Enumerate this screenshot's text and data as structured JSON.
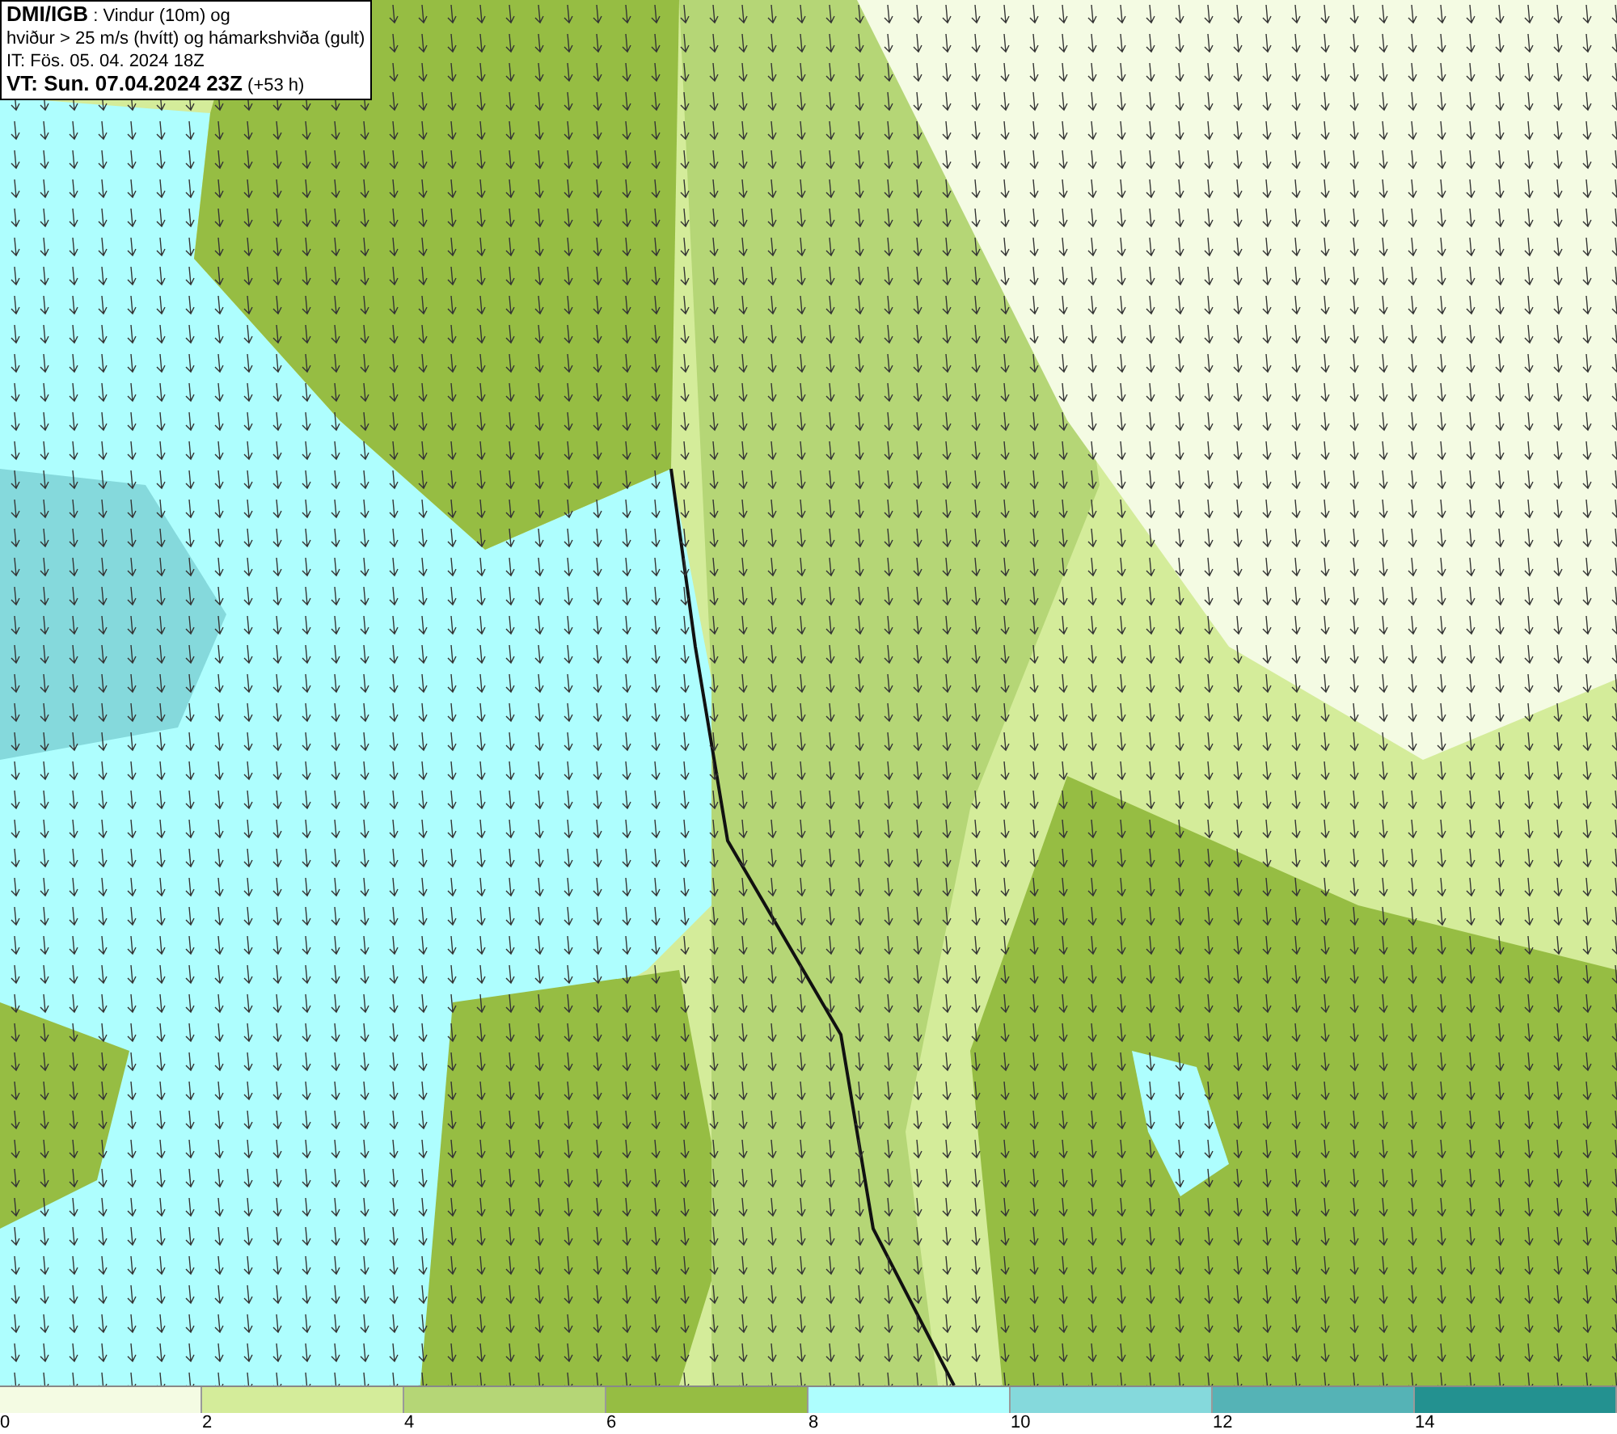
{
  "title_box": {
    "lines": [
      "**DMI/IGB** : Vindur (10m) og",
      "hviður > 25 m/s (hvítt) og hámarkshviða (gult)",
      "IT: Fös. 05. 04. 2024 18Z",
      "**VT: Sun. 07.04.2024 23Z** (+53 h)"
    ]
  },
  "legend": {
    "segments": [
      {
        "color": "#f4fbe3"
      },
      {
        "color": "#d4ec9a"
      },
      {
        "color": "#b5d676"
      },
      {
        "color": "#96bd43"
      },
      {
        "color": "#aefefe"
      },
      {
        "color": "#85d9dc"
      },
      {
        "color": "#55b3b6"
      },
      {
        "color": "#239190"
      }
    ],
    "ticks": [
      "0",
      "2",
      "4",
      "6",
      "8",
      "10",
      "12",
      "14"
    ]
  }
}
